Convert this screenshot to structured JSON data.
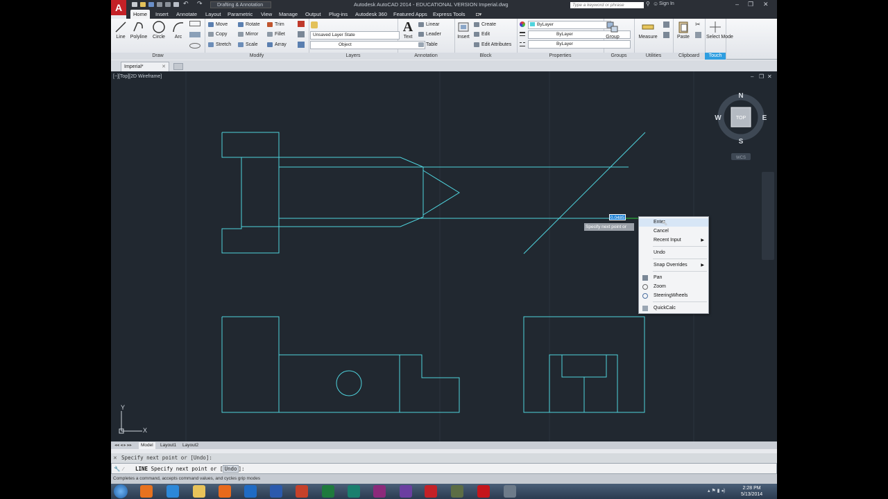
{
  "titlebar": {
    "title": "Autodesk AutoCAD 2014 - EDUCATIONAL VERSION    Imperial.dwg",
    "workspace": "Drafting & Annotation",
    "search_placeholder": "Type a keyword or phrase",
    "sign_in": "Sign In"
  },
  "ribbon_tabs": [
    "Home",
    "Insert",
    "Annotate",
    "Layout",
    "Parametric",
    "View",
    "Manage",
    "Output",
    "Plug-ins",
    "Autodesk 360",
    "Featured Apps",
    "Express Tools"
  ],
  "ribbon": {
    "draw": {
      "label": "Draw",
      "line": "Line",
      "polyline": "Polyline",
      "circle": "Circle",
      "arc": "Arc"
    },
    "modify": {
      "label": "Modify",
      "move": "Move",
      "rotate": "Rotate",
      "trim": "Trim",
      "copy": "Copy",
      "mirror": "Mirror",
      "fillet": "Fillet",
      "stretch": "Stretch",
      "scale": "Scale",
      "array": "Array"
    },
    "layers": {
      "label": "Layers",
      "layer_state": "Unsaved Layer State",
      "current_layer": "Object"
    },
    "annotation": {
      "label": "Annotation",
      "text": "Text",
      "linear": "Linear",
      "leader": "Leader",
      "table": "Table"
    },
    "block": {
      "label": "Block",
      "insert": "Insert",
      "create": "Create",
      "edit": "Edit",
      "edit_attributes": "Edit Attributes"
    },
    "properties": {
      "label": "Properties",
      "color": "ByLayer",
      "lineweight": "ByLayer",
      "linetype": "ByLayer"
    },
    "groups": {
      "label": "Groups",
      "group": "Group"
    },
    "utilities": {
      "label": "Utilities",
      "measure": "Measure"
    },
    "clipboard": {
      "label": "Clipboard",
      "paste": "Paste"
    },
    "touch": {
      "label": "Touch",
      "select_mode": "Select Mode"
    }
  },
  "doc_tab": {
    "name": "Imperial*"
  },
  "viewport": {
    "label": "[−][Top][2D Wireframe]"
  },
  "viewcube": {
    "n": "N",
    "s": "S",
    "e": "E",
    "w": "W",
    "top": "TOP",
    "wcs": "WCS"
  },
  "drawing": {
    "line_color": "#4fd3dd",
    "background": "#212830"
  },
  "dynamic_input": {
    "value": "0.0485",
    "prompt": "Specify next point or"
  },
  "context_menu": {
    "items": [
      "Enter",
      "Cancel",
      "Recent Input",
      "Undo",
      "Snap Overrides",
      "Pan",
      "Zoom",
      "SteeringWheels",
      "QuickCalc"
    ]
  },
  "ucs": {
    "x": "X",
    "y": "Y"
  },
  "layout_tabs": [
    "Model",
    "Layout1",
    "Layout2"
  ],
  "command": {
    "history": "Specify next point or [Undo]:",
    "kw": "LINE",
    "prompt": "Specify next point or [",
    "opt": "Undo",
    "end": "]:",
    "status": "Completes a command, accepts command values, and cycles grip modes"
  },
  "taskbar": {
    "time": "2:28 PM",
    "date": "5/13/2014"
  }
}
